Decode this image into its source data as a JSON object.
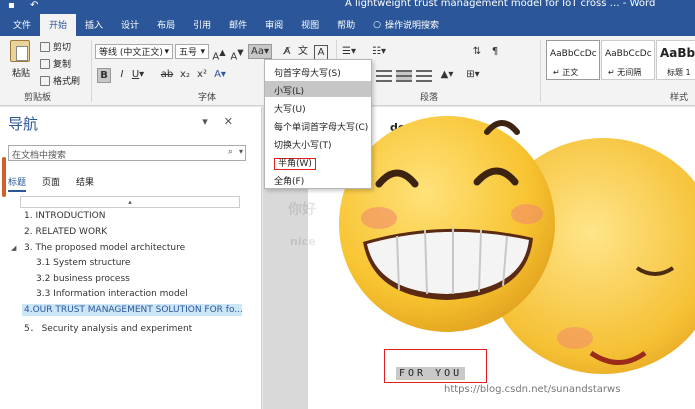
{
  "window": {
    "title": "A lightweight trust management model for IoT cross … - Word"
  },
  "tabs": [
    {
      "label": "文件"
    },
    {
      "label": "开始",
      "active": true
    },
    {
      "label": "插入"
    },
    {
      "label": "设计"
    },
    {
      "label": "布局"
    },
    {
      "label": "引用"
    },
    {
      "label": "邮件"
    },
    {
      "label": "审阅"
    },
    {
      "label": "视图"
    },
    {
      "label": "帮助"
    },
    {
      "label": "操作说明搜索"
    }
  ],
  "ribbon": {
    "clipboard": {
      "paste": "粘贴",
      "cut": "剪切",
      "copy": "复制",
      "format_painter": "格式刷",
      "group_label": "剪贴板"
    },
    "font": {
      "font_name": "等线 (中文正文)",
      "font_size": "五号",
      "change_case_button": "Aa",
      "group_label": "字体"
    },
    "paragraph": {
      "group_label": "段落"
    },
    "styles": {
      "items": [
        {
          "sample": "AaBbCcDc",
          "name": "正文"
        },
        {
          "sample": "AaBbCcDc",
          "name": "无间隔"
        },
        {
          "sample": "AaBb",
          "name": "标题 1"
        }
      ],
      "group_label": "样式"
    }
  },
  "change_case_menu": {
    "items": [
      {
        "label": "句首字母大写(S)"
      },
      {
        "label": "小写(L)",
        "hovered": true
      },
      {
        "label": "大写(U)"
      },
      {
        "label": "每个单词首字母大写(C)"
      },
      {
        "label": "切换大小写(T)"
      },
      {
        "label": "半角(W)",
        "highlighted_box": true
      },
      {
        "label": "全角(F)"
      }
    ]
  },
  "navigation": {
    "title": "导航",
    "search_placeholder": "在文档中搜索",
    "tabs": [
      {
        "label": "标题",
        "active": true
      },
      {
        "label": "页面"
      },
      {
        "label": "结果"
      }
    ],
    "headings": [
      {
        "label": "1. INTRODUCTION"
      },
      {
        "label": "2. RELATED WORK"
      },
      {
        "label": "3. The proposed model architecture"
      },
      {
        "label": "3.1 System structure"
      },
      {
        "label": "3.2 business process"
      },
      {
        "label": "3.3 Information interaction model"
      },
      {
        "label": "4.OUR TRUST MANAGEMENT SOLUTION FOR fo..."
      },
      {
        "label": "5． Security analysis and experiment"
      }
    ]
  },
  "document": {
    "partial_heading": "domain",
    "selected_text": "FOR YOU",
    "watermark": "https://blog.csdn.net/sunandstarws"
  },
  "colors": {
    "accent": "#2b579a",
    "highlight_box": "#e02020",
    "emoji_yellow": "#f7c330"
  }
}
